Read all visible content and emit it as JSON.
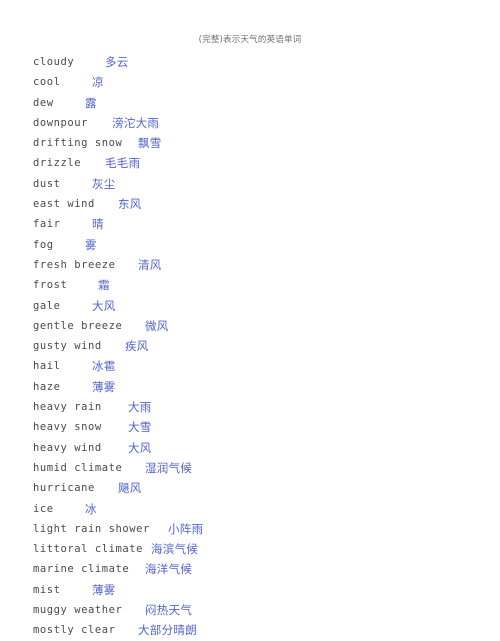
{
  "document": {
    "title": "(完整)表示天气的英语单词",
    "title_color": "#6f6f6f",
    "term_color": "#4a4a4a",
    "translation_color": "#5463cc",
    "background_color": "#ffffff"
  },
  "entries": [
    {
      "term": "cloudy",
      "translation": "多云",
      "indent": 72
    },
    {
      "term": "cool",
      "translation": "凉",
      "indent": 59
    },
    {
      "term": "dew",
      "translation": "露",
      "indent": 52
    },
    {
      "term": "downpour",
      "translation": "滂沱大雨",
      "indent": 79
    },
    {
      "term": "drifting snow",
      "translation": "飘雪",
      "indent": 105
    },
    {
      "term": "drizzle",
      "translation": "毛毛雨",
      "indent": 72
    },
    {
      "term": "dust",
      "translation": "灰尘",
      "indent": 59
    },
    {
      "term": "east wind",
      "translation": "东风",
      "indent": 85
    },
    {
      "term": "fair",
      "translation": "晴",
      "indent": 59
    },
    {
      "term": "fog",
      "translation": "雾",
      "indent": 52
    },
    {
      "term": "fresh breeze",
      "translation": "清风",
      "indent": 105
    },
    {
      "term": "frost",
      "translation": "霜",
      "indent": 65
    },
    {
      "term": "gale",
      "translation": "大风",
      "indent": 59
    },
    {
      "term": "gentle breeze",
      "translation": "微风",
      "indent": 112
    },
    {
      "term": "gusty wind",
      "translation": "疾风",
      "indent": 92
    },
    {
      "term": "hail",
      "translation": "冰雹",
      "indent": 59
    },
    {
      "term": "haze",
      "translation": "薄雾",
      "indent": 59
    },
    {
      "term": "heavy rain",
      "translation": "大雨",
      "indent": 95
    },
    {
      "term": "heavy snow",
      "translation": "大雪",
      "indent": 95
    },
    {
      "term": "heavy wind",
      "translation": "大风",
      "indent": 95
    },
    {
      "term": "humid climate",
      "translation": "湿润气候",
      "indent": 112
    },
    {
      "term": "hurricane",
      "translation": "飓风",
      "indent": 85
    },
    {
      "term": "ice",
      "translation": "冰",
      "indent": 52
    },
    {
      "term": "light rain shower",
      "translation": "小阵雨",
      "indent": 135
    },
    {
      "term": "littoral climate",
      "translation": "海滨气候",
      "indent": 118
    },
    {
      "term": "marine climate",
      "translation": "海洋气候",
      "indent": 112
    },
    {
      "term": "mist",
      "translation": "薄雾",
      "indent": 59
    },
    {
      "term": "muggy weather",
      "translation": "闷热天气",
      "indent": 112
    },
    {
      "term": "mostly clear",
      "translation": "大部分晴朗",
      "indent": 105
    }
  ]
}
